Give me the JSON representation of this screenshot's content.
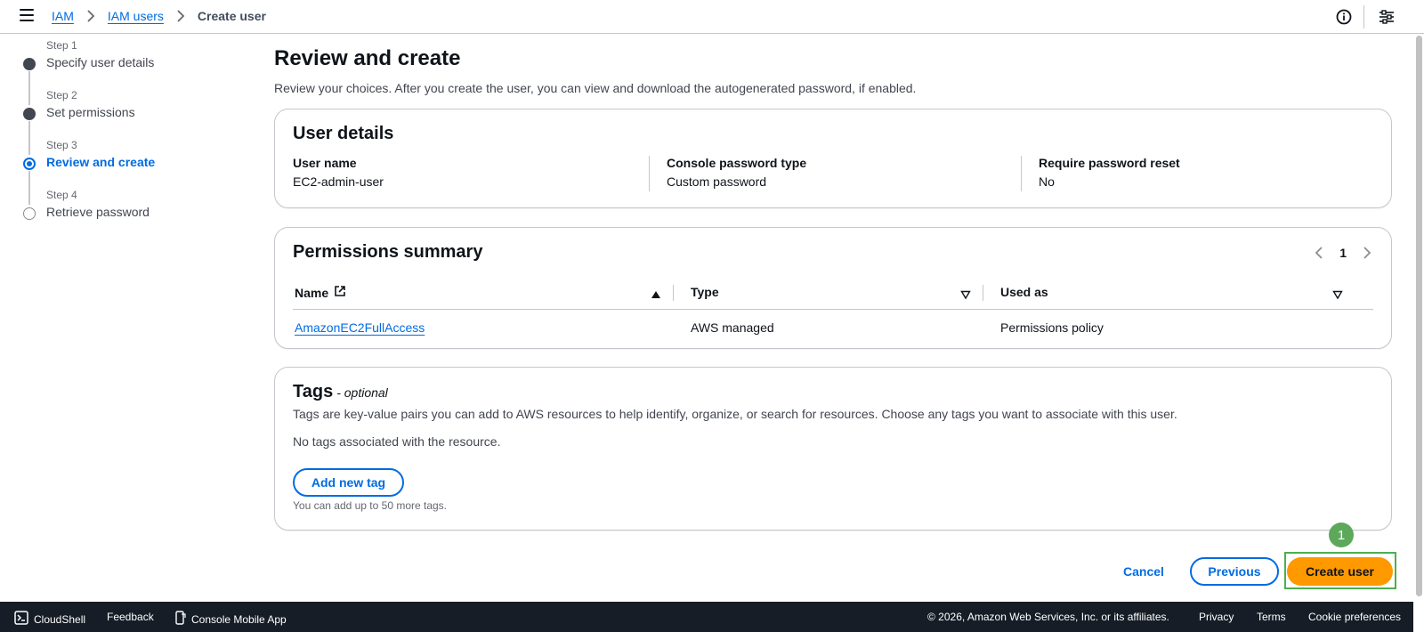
{
  "breadcrumb": {
    "items": [
      "IAM",
      "IAM users"
    ],
    "current": "Create user"
  },
  "steps": [
    {
      "number": "Step 1",
      "title": "Specify user details",
      "state": "complete"
    },
    {
      "number": "Step 2",
      "title": "Set permissions",
      "state": "complete"
    },
    {
      "number": "Step 3",
      "title": "Review and create",
      "state": "active"
    },
    {
      "number": "Step 4",
      "title": "Retrieve password",
      "state": "pending"
    }
  ],
  "page": {
    "title": "Review and create",
    "description": "Review your choices. After you create the user, you can view and download the autogenerated password, if enabled."
  },
  "user_details": {
    "title": "User details",
    "fields": [
      {
        "label": "User name",
        "value": "EC2-admin-user"
      },
      {
        "label": "Console password type",
        "value": "Custom password"
      },
      {
        "label": "Require password reset",
        "value": "No"
      }
    ]
  },
  "permissions": {
    "title": "Permissions summary",
    "page": "1",
    "columns": [
      "Name",
      "Type",
      "Used as"
    ],
    "rows": [
      {
        "name": "AmazonEC2FullAccess",
        "type": "AWS managed",
        "used_as": "Permissions policy"
      }
    ]
  },
  "tags": {
    "title": "Tags",
    "optional": "- optional",
    "description": "Tags are key-value pairs you can add to AWS resources to help identify, organize, or search for resources. Choose any tags you want to associate with this user.",
    "empty": "No tags associated with the resource.",
    "add_label": "Add new tag",
    "hint": "You can add up to 50 more tags."
  },
  "actions": {
    "cancel": "Cancel",
    "previous": "Previous",
    "create": "Create user"
  },
  "marker": "1",
  "footer": {
    "cloudshell": "CloudShell",
    "feedback": "Feedback",
    "mobile": "Console Mobile App",
    "copyright": "© 2026, Amazon Web Services, Inc. or its affiliates.",
    "privacy": "Privacy",
    "terms": "Terms",
    "cookies": "Cookie preferences"
  },
  "colors": {
    "link": "#006ce0",
    "primary": "#ff9900",
    "footer_bg": "#161d26",
    "highlight": "#4caf50"
  },
  "icons": [
    "menu-icon",
    "chevron-right-icon",
    "info-icon",
    "settings-sliders-icon",
    "external-link-icon",
    "sort-up-icon",
    "sort-down-icon",
    "chevron-left-icon",
    "terminal-icon",
    "mobile-app-icon"
  ]
}
